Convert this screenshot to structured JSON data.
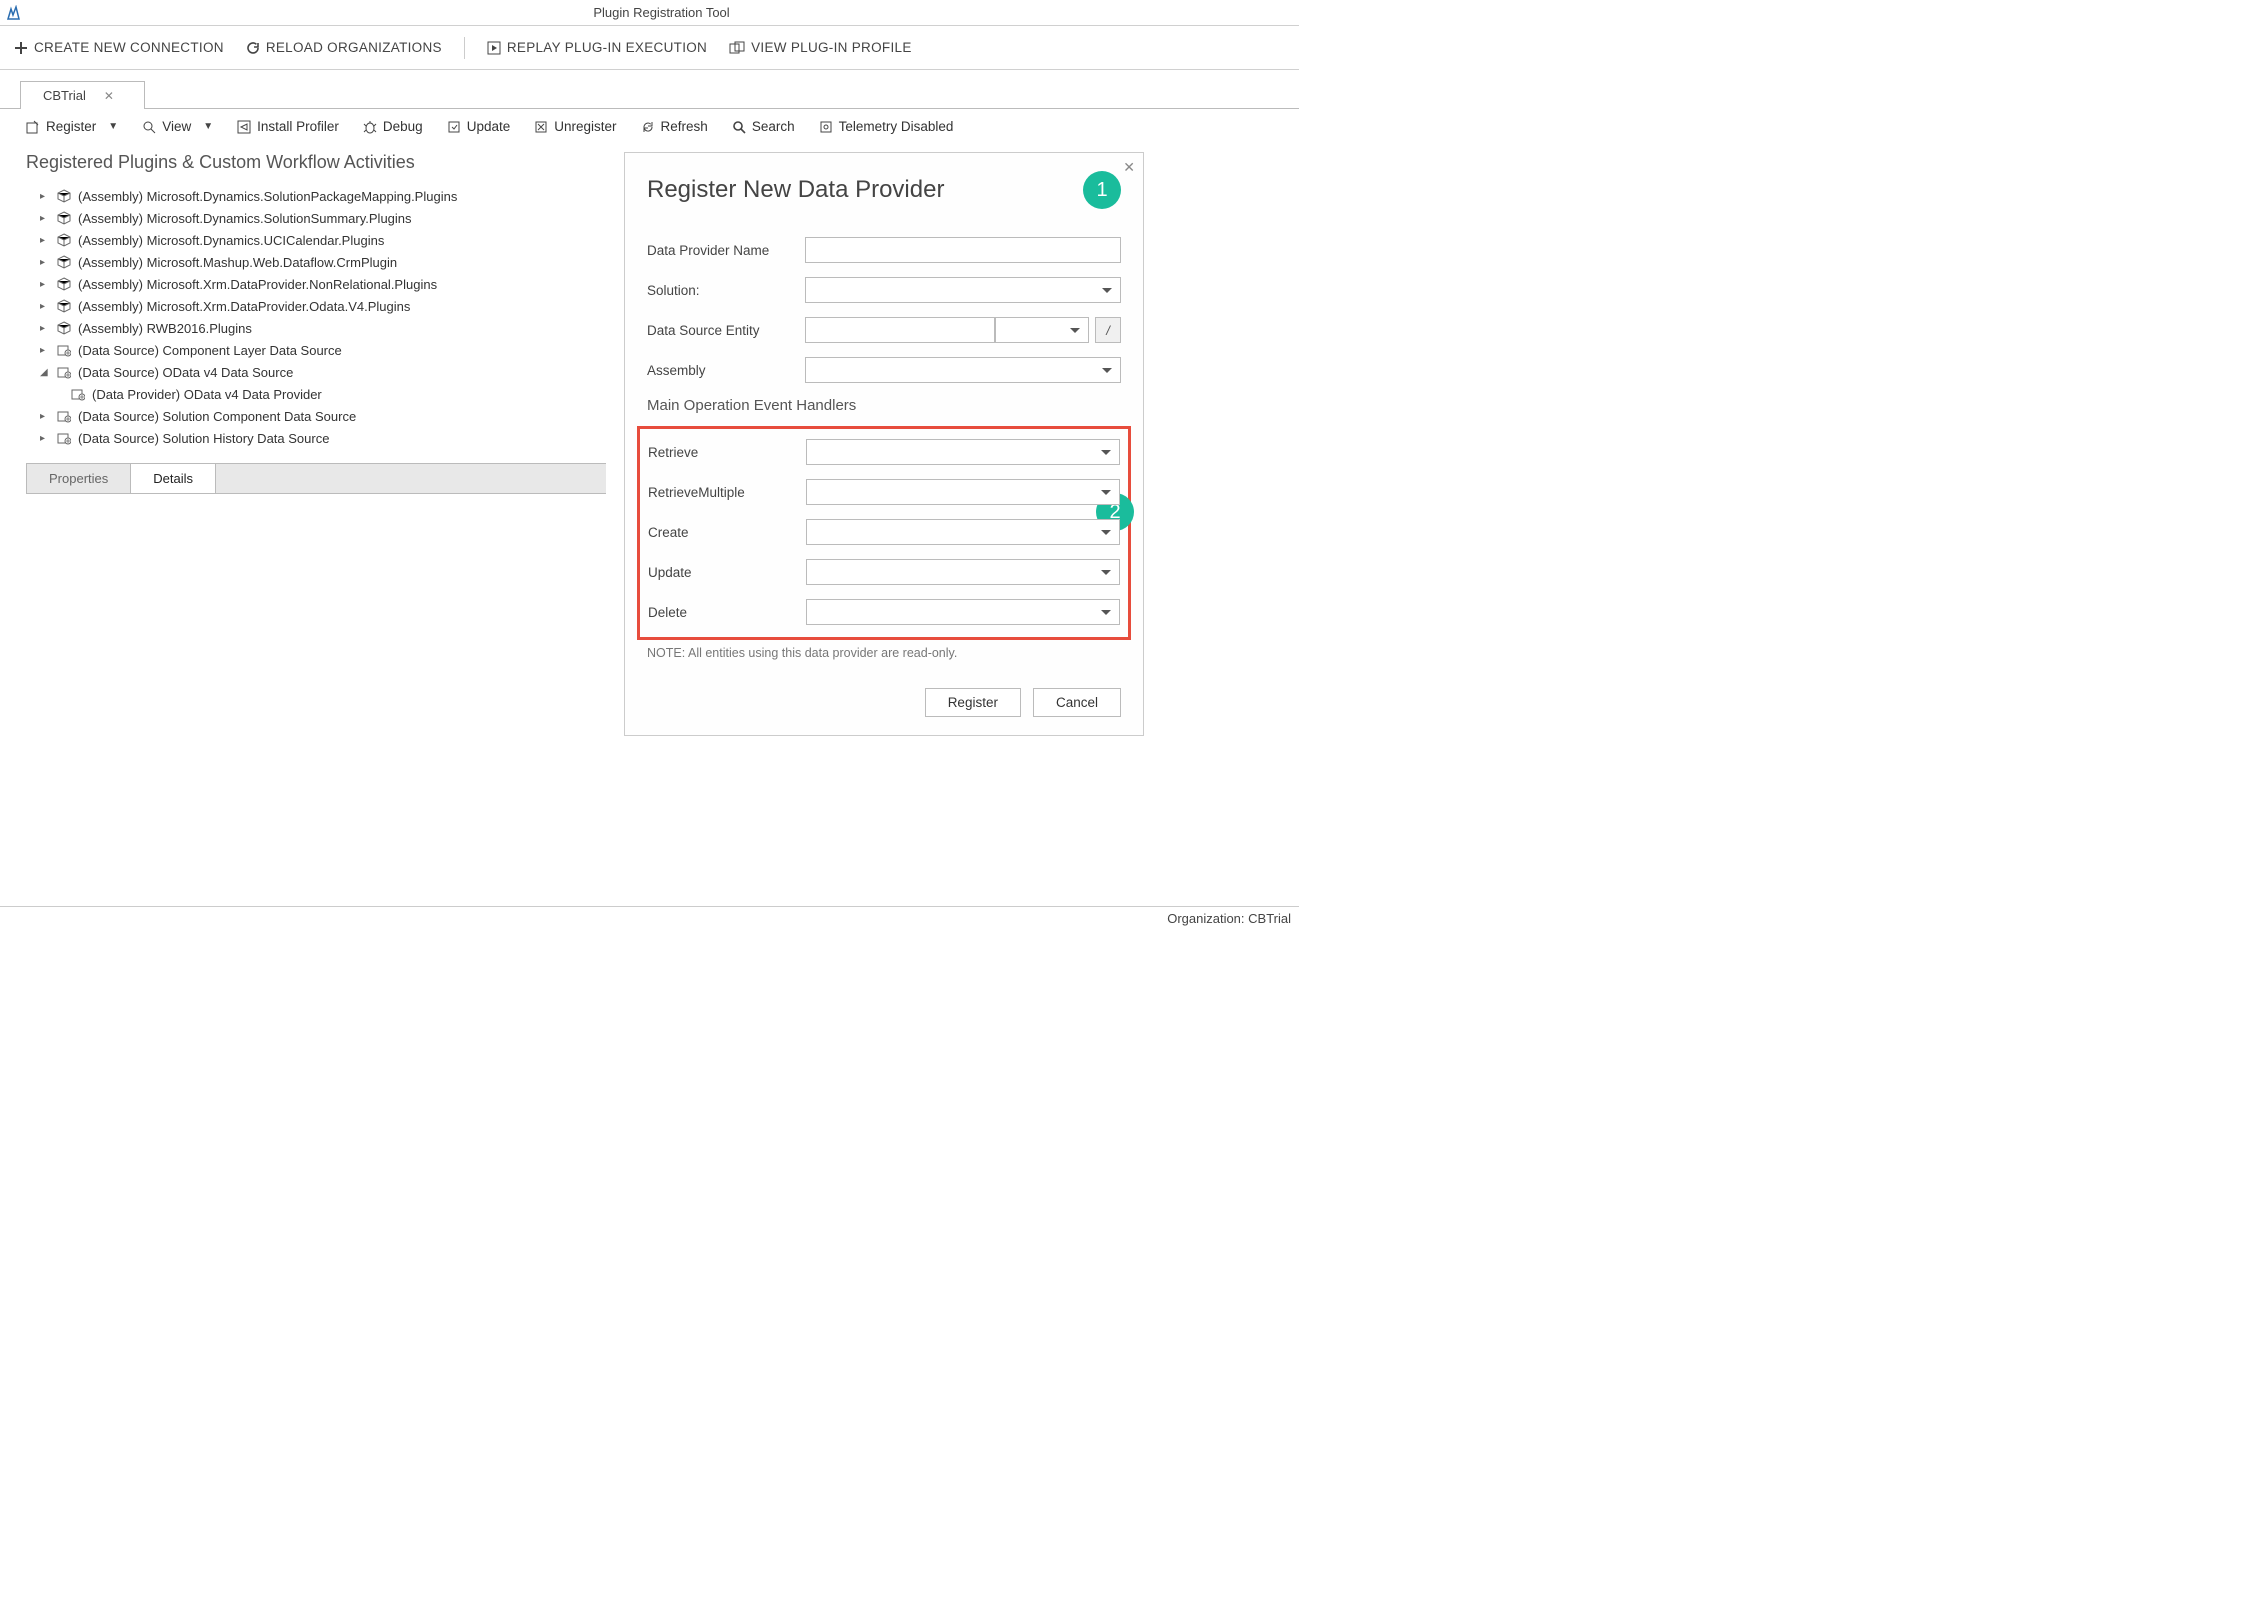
{
  "window": {
    "title": "Plugin Registration Tool"
  },
  "main_toolbar": {
    "create": "CREATE NEW CONNECTION",
    "reload": "RELOAD ORGANIZATIONS",
    "replay": "REPLAY PLUG-IN EXECUTION",
    "profile": "VIEW PLUG-IN PROFILE"
  },
  "tabs": {
    "active": "CBTrial"
  },
  "sub_toolbar": {
    "register": "Register",
    "view": "View",
    "install_profiler": "Install Profiler",
    "debug": "Debug",
    "update": "Update",
    "unregister": "Unregister",
    "refresh": "Refresh",
    "search": "Search",
    "telemetry": "Telemetry Disabled"
  },
  "tree": {
    "title": "Registered Plugins & Custom Workflow Activities",
    "items": [
      {
        "label": "(Assembly) Microsoft.Dynamics.SolutionPackageMapping.Plugins",
        "type": "assembly",
        "expander": "▸"
      },
      {
        "label": "(Assembly) Microsoft.Dynamics.SolutionSummary.Plugins",
        "type": "assembly",
        "expander": "▸"
      },
      {
        "label": "(Assembly) Microsoft.Dynamics.UCICalendar.Plugins",
        "type": "assembly",
        "expander": "▸"
      },
      {
        "label": "(Assembly) Microsoft.Mashup.Web.Dataflow.CrmPlugin",
        "type": "assembly",
        "expander": "▸"
      },
      {
        "label": "(Assembly) Microsoft.Xrm.DataProvider.NonRelational.Plugins",
        "type": "assembly",
        "expander": "▸"
      },
      {
        "label": "(Assembly) Microsoft.Xrm.DataProvider.Odata.V4.Plugins",
        "type": "assembly",
        "expander": "▸"
      },
      {
        "label": "(Assembly) RWB2016.Plugins",
        "type": "assembly",
        "expander": "▸"
      },
      {
        "label": "(Data Source) Component Layer Data Source",
        "type": "datasource",
        "expander": "▸"
      },
      {
        "label": "(Data Source) OData v4 Data Source",
        "type": "datasource",
        "expander": "◢",
        "children": [
          {
            "label": "(Data Provider) OData v4 Data Provider",
            "type": "dataprovider"
          }
        ]
      },
      {
        "label": "(Data Source) Solution Component Data Source",
        "type": "datasource",
        "expander": "▸"
      },
      {
        "label": "(Data Source) Solution History Data Source",
        "type": "datasource",
        "expander": "▸"
      }
    ]
  },
  "lower_tabs": {
    "properties": "Properties",
    "details": "Details"
  },
  "dialog": {
    "title": "Register New Data Provider",
    "callout1": "1",
    "callout2": "2",
    "labels": {
      "data_provider_name": "Data Provider Name",
      "solution": "Solution:",
      "data_source_entity": "Data Source Entity",
      "assembly": "Assembly",
      "section": "Main Operation Event Handlers",
      "retrieve": "Retrieve",
      "retrieve_multiple": "RetrieveMultiple",
      "create": "Create",
      "update": "Update",
      "delete": "Delete",
      "slash": "/"
    },
    "note": "NOTE: All entities using this data provider are read-only.",
    "buttons": {
      "register": "Register",
      "cancel": "Cancel"
    }
  },
  "statusbar": {
    "org": "Organization: CBTrial "
  }
}
